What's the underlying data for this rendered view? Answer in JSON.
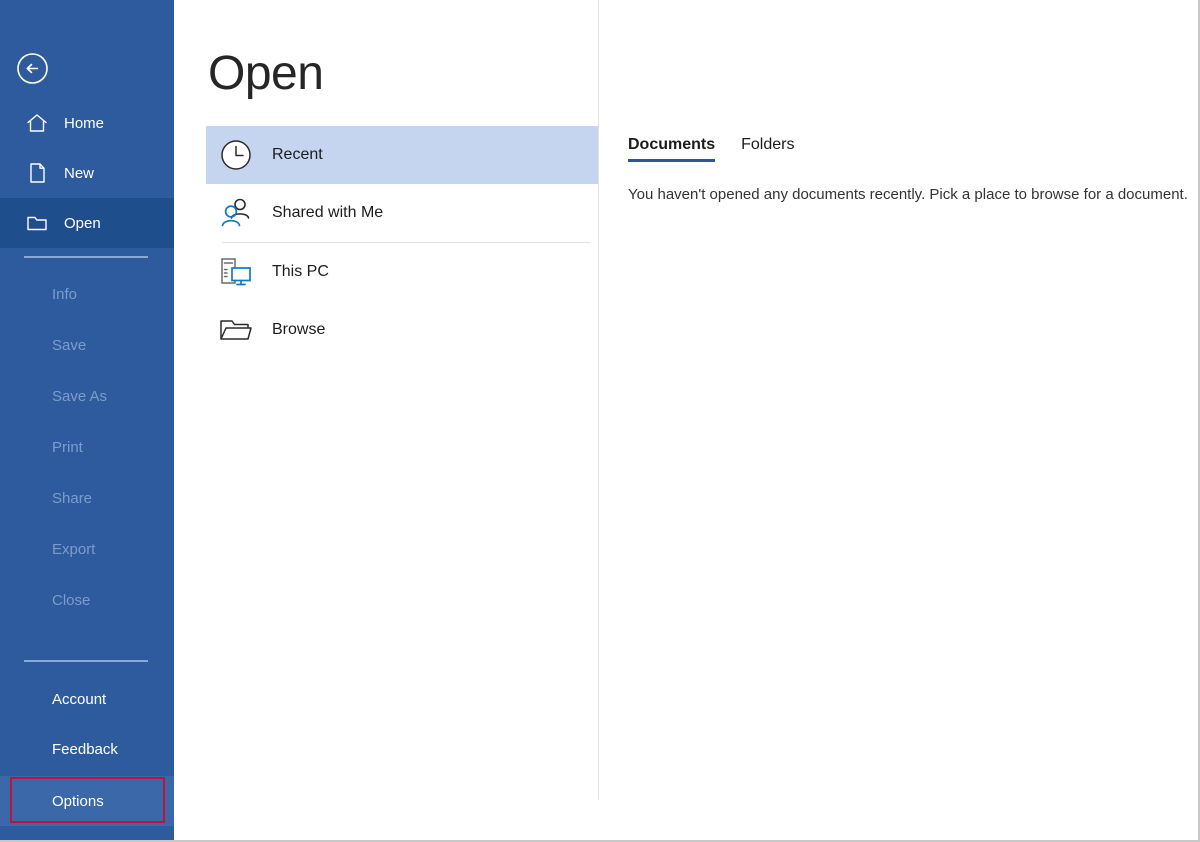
{
  "colors": {
    "sidebar_blue": "#2e5b9e",
    "sidebar_selected": "#1f4e8c",
    "sidebar_hover": "#3a68a8",
    "accent_blue": "#2b579a",
    "icon_blue": "#0f7ac8",
    "highlight_red": "#c1123c",
    "recent_selected": "#c5d5ef",
    "disabled_text": "#7d9ccb"
  },
  "sidebar": {
    "back_label": "Back",
    "back_icon": "back-arrow-circle-icon",
    "primary_items": [
      {
        "label": "Home",
        "icon": "home-icon",
        "state": "normal"
      },
      {
        "label": "New",
        "icon": "new-document-icon",
        "state": "normal"
      },
      {
        "label": "Open",
        "icon": "open-folder-icon",
        "state": "selected"
      }
    ],
    "disabled_items": [
      {
        "label": "Info"
      },
      {
        "label": "Save"
      },
      {
        "label": "Save As"
      },
      {
        "label": "Print"
      },
      {
        "label": "Share"
      },
      {
        "label": "Export"
      },
      {
        "label": "Close"
      }
    ],
    "bottom_items": [
      {
        "label": "Account",
        "state": "normal"
      },
      {
        "label": "Feedback",
        "state": "normal"
      },
      {
        "label": "Options",
        "state": "highlighted"
      }
    ]
  },
  "main": {
    "title": "Open",
    "places": [
      {
        "label": "Recent",
        "icon": "clock-icon",
        "state": "selected"
      },
      {
        "label": "Shared with Me",
        "icon": "people-icon",
        "state": "normal"
      },
      {
        "label": "This PC",
        "icon": "computer-icon",
        "state": "normal"
      },
      {
        "label": "Browse",
        "icon": "folder-open-icon",
        "state": "normal"
      }
    ],
    "tabs": [
      {
        "label": "Documents",
        "active": true
      },
      {
        "label": "Folders",
        "active": false
      }
    ],
    "empty_message": "You haven't opened any documents recently. Pick a place to browse for a document."
  }
}
